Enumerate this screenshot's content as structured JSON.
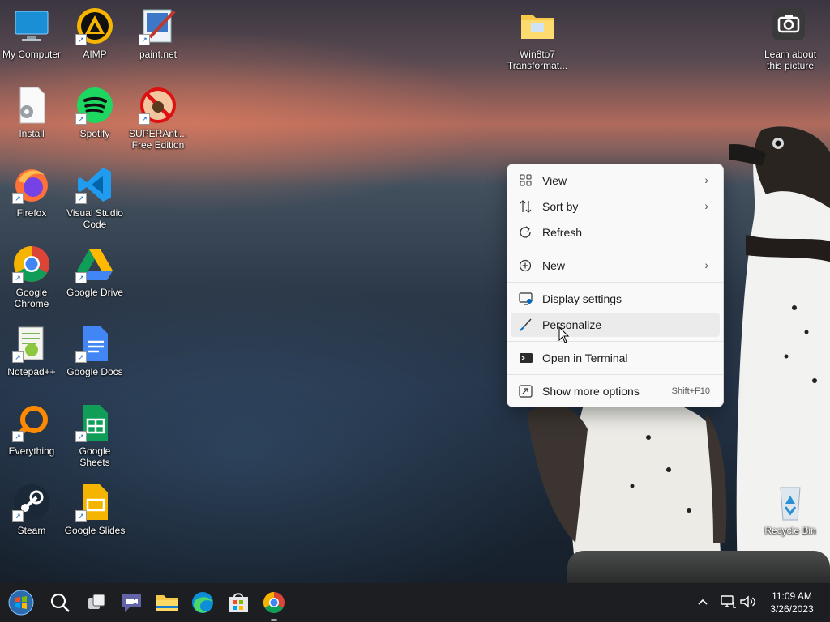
{
  "desktop": {
    "icons": [
      {
        "label": "My Computer"
      },
      {
        "label": "AIMP"
      },
      {
        "label": "paint.net"
      },
      {
        "label": "Install"
      },
      {
        "label": "Spotify"
      },
      {
        "label": "SUPERAnti... Free Edition"
      },
      {
        "label": "Firefox"
      },
      {
        "label": "Visual Studio Code"
      },
      {
        "label": "Google Chrome"
      },
      {
        "label": "Google Drive"
      },
      {
        "label": "Notepad++"
      },
      {
        "label": "Google Docs"
      },
      {
        "label": "Everything"
      },
      {
        "label": "Google Sheets"
      },
      {
        "label": "Steam"
      },
      {
        "label": "Google Slides"
      },
      {
        "label": "Win8to7 Transformat..."
      },
      {
        "label": "Learn about this picture"
      },
      {
        "label": "Recycle Bin"
      }
    ]
  },
  "context_menu": {
    "items": [
      {
        "label": "View",
        "icon": "grid-icon",
        "submenu": true
      },
      {
        "label": "Sort by",
        "icon": "sort-icon",
        "submenu": true
      },
      {
        "label": "Refresh",
        "icon": "refresh-icon"
      },
      {
        "label": "New",
        "icon": "plus-circle-icon",
        "submenu": true
      },
      {
        "label": "Display settings",
        "icon": "display-icon"
      },
      {
        "label": "Personalize",
        "icon": "brush-icon",
        "hovered": true
      },
      {
        "label": "Open in Terminal",
        "icon": "terminal-icon"
      },
      {
        "label": "Show more options",
        "icon": "more-options-icon",
        "shortcut": "Shift+F10"
      }
    ]
  },
  "taskbar": {
    "apps": [
      "start-icon",
      "search-icon",
      "task-view-icon",
      "chat-icon",
      "file-explorer-icon",
      "edge-icon",
      "store-icon",
      "chrome-icon"
    ],
    "tray": {
      "time": "11:09 AM",
      "date": "3/26/2023"
    }
  },
  "colors": {
    "menu_bg": "#f9f9f9",
    "taskbar_bg": "#1c1e22",
    "accent": "#0067c0"
  }
}
